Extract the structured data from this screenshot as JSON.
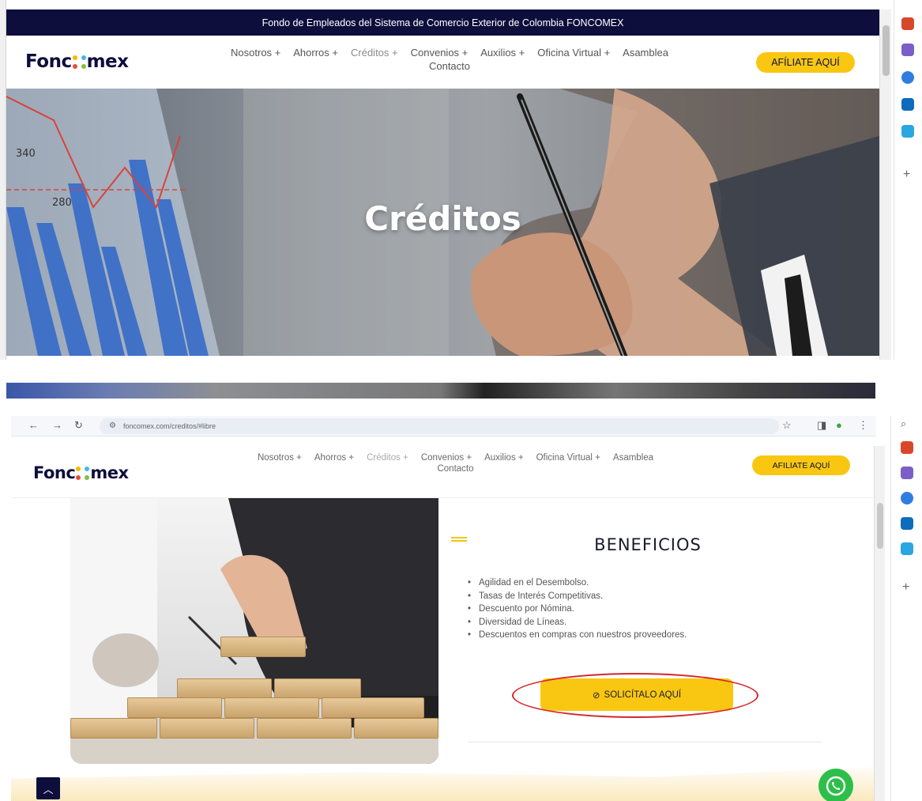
{
  "site": {
    "banner": "Fondo de Empleados del Sistema de Comercio Exterior de Colombia FONCOMEX",
    "logo_left": "Fonc",
    "logo_right": "mex",
    "nav": [
      {
        "label": "Nosotros +"
      },
      {
        "label": "Ahorros +"
      },
      {
        "label": "Créditos +"
      },
      {
        "label": "Convenios +"
      },
      {
        "label": "Auxilios +"
      },
      {
        "label": "Oficina Virtual +"
      },
      {
        "label": "Asamblea"
      },
      {
        "label": "Contacto"
      }
    ],
    "cta": "AFÍLIATE AQUÍ",
    "hero_title": "Créditos"
  },
  "browser": {
    "url": "foncomex.com/creditos/#libre"
  },
  "bottom_nav": {
    "cta": "AFILIATE AQUÍ"
  },
  "benefits": {
    "heading": "BENEFICIOS",
    "items": [
      "Agilidad en el Desembolso.",
      "Tasas de Interés Competitivas.",
      "Descuento por Nómina.",
      "Diversidad de Líneas.",
      "Descuentos en compras con nuestros proveedores."
    ],
    "button": "SOLICÍTALO AQUÍ"
  },
  "colors": {
    "navy": "#0d0e3c",
    "yellow": "#f9c712",
    "highlight_red": "#d6262a",
    "whatsapp_green": "#2dbf4a"
  },
  "icons": [
    "briefcase-icon",
    "people-icon",
    "copilot-icon",
    "outlook-icon",
    "send-icon",
    "plus-icon",
    "search-icon",
    "back-icon",
    "forward-icon",
    "reload-icon",
    "star-icon",
    "whatsapp-icon",
    "chevron-up-icon",
    "check-circle-icon"
  ]
}
